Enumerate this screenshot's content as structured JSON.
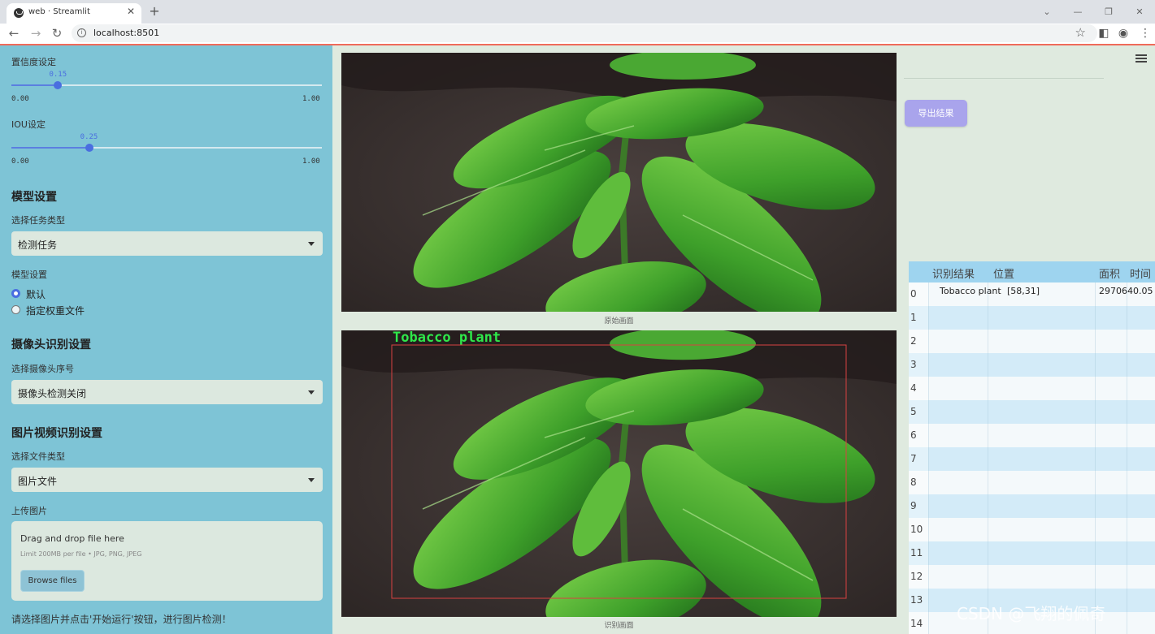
{
  "browser": {
    "tab_title": "web · Streamlit",
    "url": "localhost:8501"
  },
  "sidebar": {
    "confidence": {
      "label": "置信度设定",
      "value": "0.15",
      "value_num": 0.15,
      "min": "0.00",
      "max": "1.00"
    },
    "iou": {
      "label": "IOU设定",
      "value": "0.25",
      "value_num": 0.25,
      "min": "0.00",
      "max": "1.00"
    },
    "model_section": {
      "title": "模型设置",
      "task_label": "选择任务类型",
      "task_value": "检测任务",
      "model_label": "模型设置",
      "options": [
        "默认",
        "指定权重文件"
      ],
      "selected_option": "默认"
    },
    "camera_section": {
      "title": "摄像头识别设置",
      "cam_label": "选择摄像头序号",
      "cam_value": "摄像头检测关闭"
    },
    "media_section": {
      "title": "图片视频识别设置",
      "type_label": "选择文件类型",
      "type_value": "图片文件",
      "upload_label": "上传图片"
    },
    "uploader": {
      "drag_text": "Drag and drop file here",
      "limit_text": "Limit 200MB per file • JPG, PNG, JPEG",
      "browse_label": "Browse files"
    },
    "hint": "请选择图片并点击'开始运行'按钮，进行图片检测！"
  },
  "main": {
    "original_caption": "原始画面",
    "detected_caption": "识别画面",
    "detection_label": "Tobacco plant",
    "box_color": "#d84141",
    "label_color": "#2ee84a"
  },
  "right": {
    "export_label": "导出结果",
    "table": {
      "headers": [
        "识别结果",
        "位置",
        "面积",
        "时间"
      ],
      "rows": [
        {
          "index": "0",
          "result": "Tobacco plant",
          "position": "[58,31]",
          "area": "2970640.05"
        },
        {
          "index": "1"
        },
        {
          "index": "2"
        },
        {
          "index": "3"
        },
        {
          "index": "4"
        },
        {
          "index": "5"
        },
        {
          "index": "6"
        },
        {
          "index": "7"
        },
        {
          "index": "8"
        },
        {
          "index": "9"
        },
        {
          "index": "10"
        },
        {
          "index": "11"
        },
        {
          "index": "12"
        },
        {
          "index": "13"
        },
        {
          "index": "14"
        }
      ]
    }
  },
  "watermark": "CSDN @飞翔的佩奇"
}
